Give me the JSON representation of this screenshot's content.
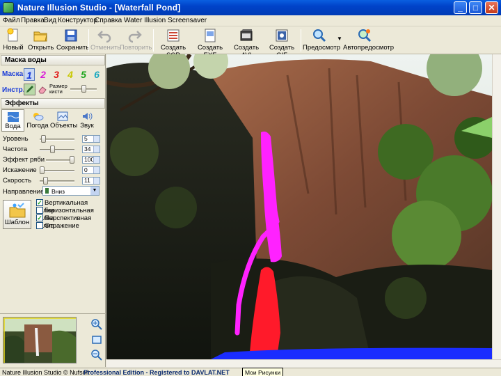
{
  "window": {
    "title": "Nature Illusion Studio - [Waterfall Pond]"
  },
  "menu": {
    "items": [
      "Файл",
      "Правка",
      "Вид",
      "Конструктор",
      "Справка",
      "Water Illusion Screensaver"
    ]
  },
  "toolbar": {
    "new": "Новый",
    "open": "Открыть",
    "save": "Сохранить",
    "undo": "Отменить",
    "redo": "Повторить",
    "create_scr": "Создать SCR",
    "create_exe": "Создать EXE",
    "create_avi": "Создать AVI",
    "create_gif": "Создать GIF",
    "preview": "Предосмотр",
    "autopreview": "Автопредосмотр"
  },
  "mask_panel": {
    "title": "Маска воды",
    "mask_label": "Маска",
    "masks": [
      {
        "num": "1",
        "color": "#1a3cd8"
      },
      {
        "num": "2",
        "color": "#d81ad8"
      },
      {
        "num": "3",
        "color": "#e01818"
      },
      {
        "num": "4",
        "color": "#c8c800"
      },
      {
        "num": "5",
        "color": "#1aa41a"
      },
      {
        "num": "6",
        "color": "#17a8c0"
      }
    ],
    "tool_label": "Инстр.",
    "brush_size_label": "Размер кисти",
    "brush_size_level": 0.5
  },
  "effects": {
    "title": "Эффекты",
    "tabs": [
      "Вода",
      "Погода",
      "Объекты",
      "Звук"
    ],
    "params": [
      {
        "label": "Уровень",
        "value": "5",
        "level": 0.05
      },
      {
        "label": "Частота",
        "value": "34",
        "level": 0.34
      },
      {
        "label": "Эффект ряби",
        "value": "100",
        "level": 1.0
      },
      {
        "label": "Искажение",
        "value": "0",
        "level": 0.0
      },
      {
        "label": "Скорость",
        "value": "11",
        "level": 0.11
      }
    ],
    "direction_label": "Направление",
    "direction_value": "Вниз",
    "template_label": "Шаблон",
    "checkboxes": [
      {
        "label": "Вертикальная волна",
        "checked": true
      },
      {
        "label": "Горизонтальная волна",
        "checked": false
      },
      {
        "label": "Перспективная волна",
        "checked": true
      },
      {
        "label": "Отражение",
        "checked": false
      }
    ]
  },
  "status": {
    "left": "Nature Illusion Studio © Nufsoft",
    "edition": "Professional Edition - Registered to DAVLAT.NET",
    "tooltip": "Мои Рисунки"
  },
  "colors": {
    "accent": "#0043c9",
    "mask_magenta": "#ff22ff",
    "mask_red": "#ff1a2a",
    "mask_blue": "#1a2cff"
  }
}
